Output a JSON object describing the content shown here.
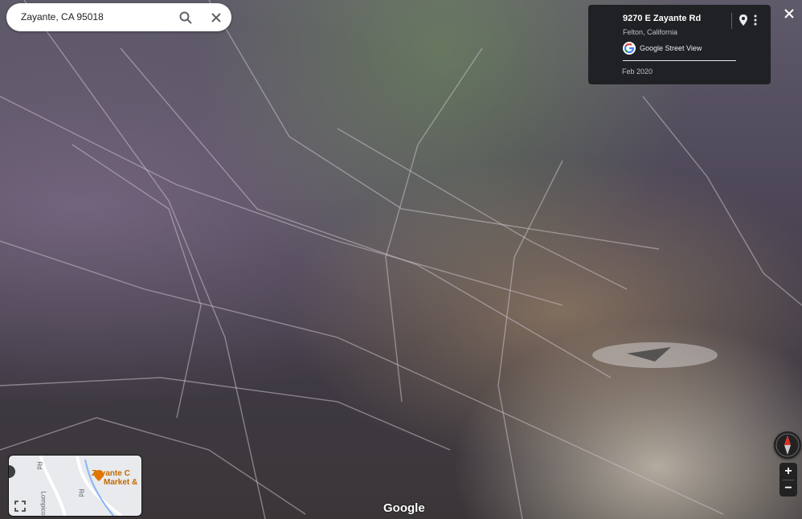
{
  "search": {
    "query": "Zayante, CA 95018",
    "search_icon": "search-icon",
    "clear_icon": "close-icon"
  },
  "info_card": {
    "address": "9270 E Zayante Rd",
    "city": "Felton, California",
    "source": "Google Street View",
    "date": "Feb 2020",
    "pin_icon": "location-pin-icon",
    "more_icon": "more-vert-icon"
  },
  "close_icon": "close-icon",
  "minimap": {
    "place_label_line1": "Zayante C",
    "place_label_line2": "Market &",
    "road_labels": [
      "Rd",
      "Lompico",
      "Rd"
    ],
    "expand_icon": "fullscreen-icon"
  },
  "controls": {
    "compass_icon": "compass-icon",
    "zoom_in": "+",
    "zoom_out": "−"
  },
  "watermark": "Google",
  "colors": {
    "card_bg": "#202124",
    "accent_orange": "#c26a00"
  }
}
